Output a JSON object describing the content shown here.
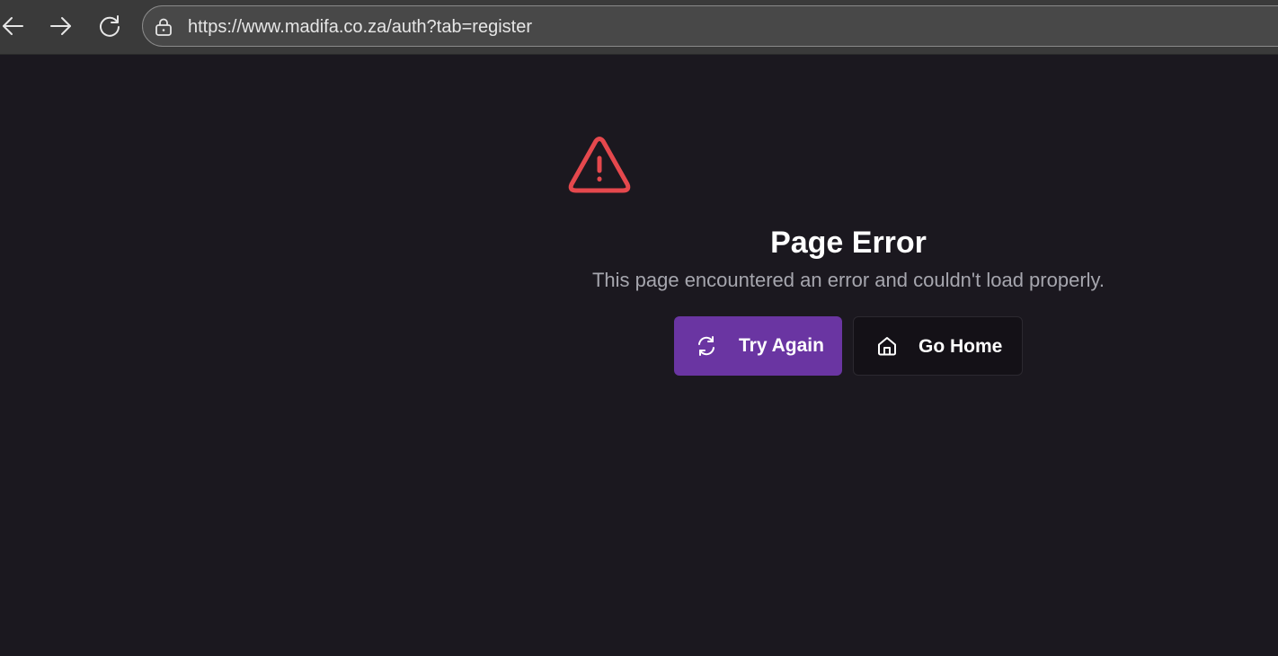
{
  "browser": {
    "url": "https://www.madifa.co.za/auth?tab=register",
    "icons": {
      "back": "back-arrow-icon",
      "forward": "forward-arrow-icon",
      "refresh": "refresh-icon",
      "site_info": "lock-icon"
    }
  },
  "error": {
    "icon": "warning-triangle-icon",
    "icon_color": "#e5484d",
    "title": "Page Error",
    "message": "This page encountered an error and couldn't load properly."
  },
  "actions": {
    "try_again": {
      "label": "Try Again",
      "icon": "refresh-icon",
      "color": "#6a35a2"
    },
    "go_home": {
      "label": "Go Home",
      "icon": "home-icon"
    }
  }
}
